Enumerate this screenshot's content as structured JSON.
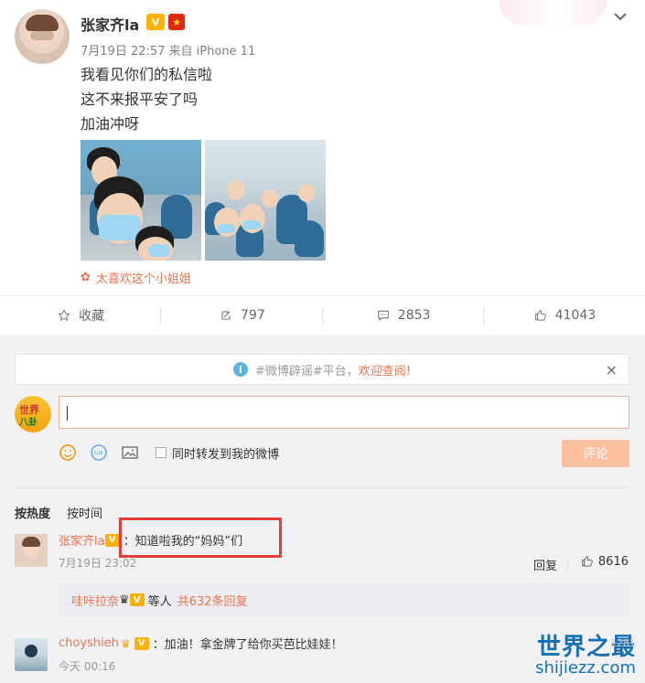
{
  "post": {
    "username": "张家齐la",
    "meta": "7月19日 22:57 来自 iPhone 11",
    "lines": [
      "我看见你们的私信啦",
      "这不来报平安了吗",
      "加油冲呀"
    ],
    "like_hint": "太喜欢这个小姐姐",
    "badge_vip_icon": "vip-badge-icon",
    "badge_flag_icon": "china-flag-icon"
  },
  "actions": {
    "favorite": "收藏",
    "repost": "797",
    "comment": "2853",
    "like": "41043"
  },
  "rumor": {
    "prefix": "#微博辟谣#平台，",
    "suffix": "欢迎查阅!"
  },
  "composer": {
    "input_value": "",
    "checkbox_label": "同时转发到我的微博",
    "submit": "评论"
  },
  "sort": {
    "hot": "按热度",
    "time": "按时间"
  },
  "comments": [
    {
      "name": "张家齐la",
      "text": "：知道啦我的“妈妈”们",
      "time": "7月19日 23:02",
      "reply": "回复",
      "likes": "8616",
      "sub_reply_user": "哇咔拉奈",
      "sub_reply_middle": "等人",
      "sub_reply_count": "共632条回复"
    },
    {
      "name": "choyshieh",
      "text": "：加油！拿金牌了给你买芭比娃娃！",
      "time": "今天 00:16"
    }
  ],
  "watermark": {
    "title": "世界之最",
    "site": "shijiezz.com",
    "ghost": "1281"
  }
}
